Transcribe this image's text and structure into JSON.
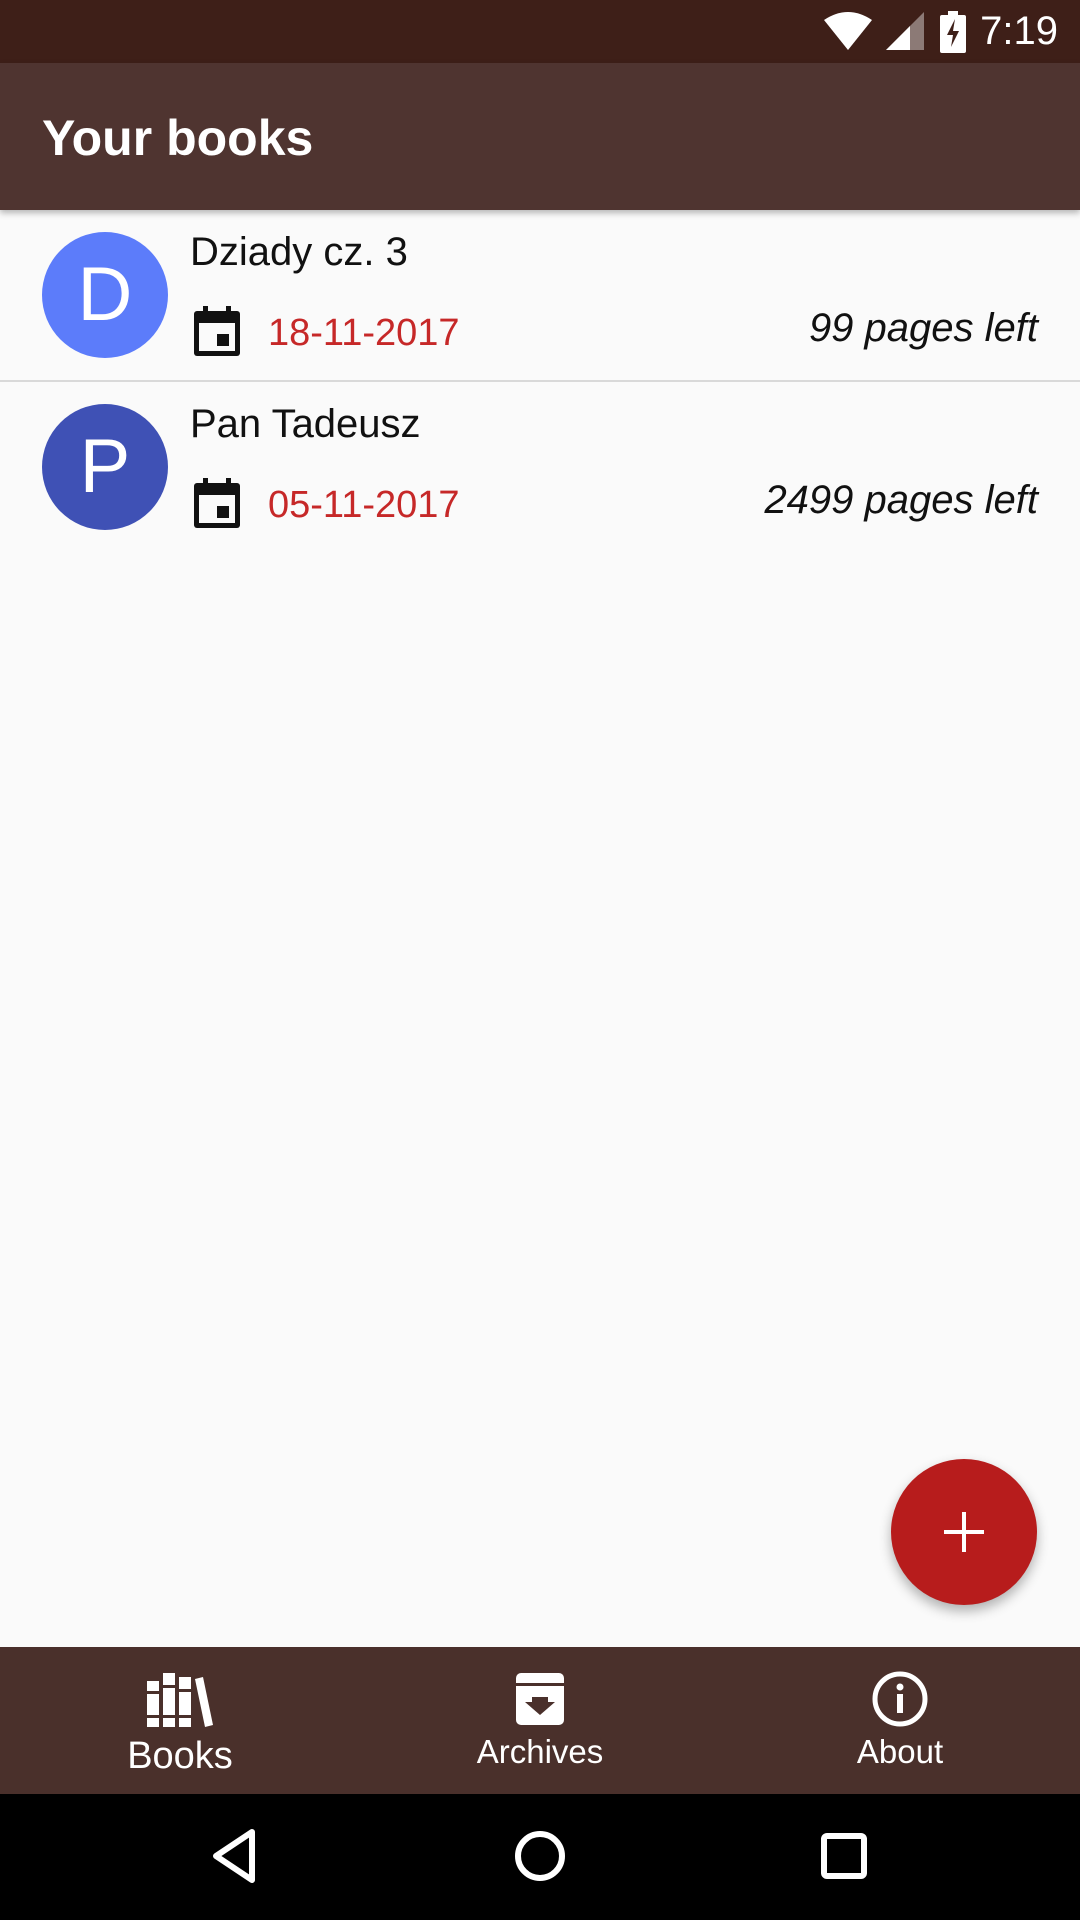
{
  "status_bar": {
    "time": "7:19"
  },
  "app_bar": {
    "title": "Your books"
  },
  "books": [
    {
      "initial": "D",
      "title": "Dziady cz. 3",
      "date": "18-11-2017",
      "pages_left": "99 pages left",
      "avatar_color": "#5c7cfa"
    },
    {
      "initial": "P",
      "title": "Pan Tadeusz",
      "date": "05-11-2017",
      "pages_left": "2499 pages left",
      "avatar_color": "#3f51b5"
    }
  ],
  "fab": {
    "icon": "plus-icon"
  },
  "bottom_nav": {
    "items": [
      {
        "label": "Books",
        "icon": "books-icon",
        "active": true
      },
      {
        "label": "Archives",
        "icon": "archive-icon",
        "active": false
      },
      {
        "label": "About",
        "icon": "info-icon",
        "active": false
      }
    ]
  },
  "colors": {
    "status_bar": "#3e1f18",
    "app_bar": "#4f3430",
    "bottom_nav": "#4a302b",
    "accent": "#b71c1c",
    "date_text": "#c62828"
  }
}
